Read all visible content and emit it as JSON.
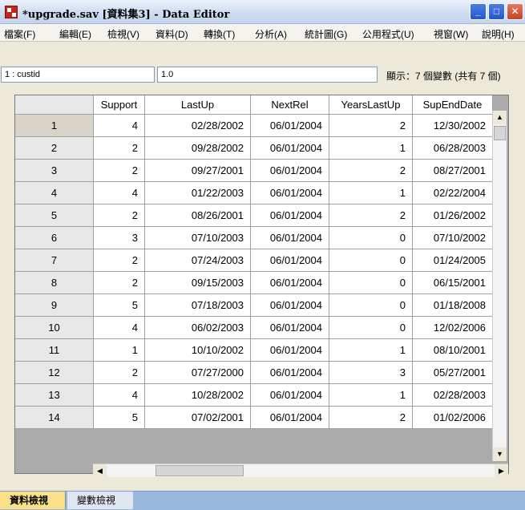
{
  "window": {
    "title": "*upgrade.sav [資料集3] - Data Editor",
    "controls": {
      "minimize": "_",
      "maximize": "□",
      "close": "✕"
    }
  },
  "menu": [
    "檔案(F)",
    "編輯(E)",
    "檢視(V)",
    "資料(D)",
    "轉換(T)",
    "分析(A)",
    "統計圖(G)",
    "公用程式(U)",
    "視窗(W)",
    "說明(H)"
  ],
  "formula": {
    "cell_ref": "1 : custid",
    "cell_value": "1.0",
    "variable_count": "顯示：7 個變數 (共有 7 個)"
  },
  "grid": {
    "columns": [
      "Support",
      "LastUp",
      "NextRel",
      "YearsLastUp",
      "SupEndDate"
    ],
    "rows": [
      {
        "num": "1",
        "values": [
          "4",
          "02/28/2002",
          "06/01/2004",
          "2",
          "12/30/2002"
        ]
      },
      {
        "num": "2",
        "values": [
          "2",
          "09/28/2002",
          "06/01/2004",
          "1",
          "06/28/2003"
        ]
      },
      {
        "num": "3",
        "values": [
          "2",
          "09/27/2001",
          "06/01/2004",
          "2",
          "08/27/2001"
        ]
      },
      {
        "num": "4",
        "values": [
          "4",
          "01/22/2003",
          "06/01/2004",
          "1",
          "02/22/2004"
        ]
      },
      {
        "num": "5",
        "values": [
          "2",
          "08/26/2001",
          "06/01/2004",
          "2",
          "01/26/2002"
        ]
      },
      {
        "num": "6",
        "values": [
          "3",
          "07/10/2003",
          "06/01/2004",
          "0",
          "07/10/2002"
        ]
      },
      {
        "num": "7",
        "values": [
          "2",
          "07/24/2003",
          "06/01/2004",
          "0",
          "01/24/2005"
        ]
      },
      {
        "num": "8",
        "values": [
          "2",
          "09/15/2003",
          "06/01/2004",
          "0",
          "06/15/2001"
        ]
      },
      {
        "num": "9",
        "values": [
          "5",
          "07/18/2003",
          "06/01/2004",
          "0",
          "01/18/2008"
        ]
      },
      {
        "num": "10",
        "values": [
          "4",
          "06/02/2003",
          "06/01/2004",
          "0",
          "12/02/2006"
        ]
      },
      {
        "num": "11",
        "values": [
          "1",
          "10/10/2002",
          "06/01/2004",
          "1",
          "08/10/2001"
        ]
      },
      {
        "num": "12",
        "values": [
          "2",
          "07/27/2000",
          "06/01/2004",
          "3",
          "05/27/2001"
        ]
      },
      {
        "num": "13",
        "values": [
          "4",
          "10/28/2002",
          "06/01/2004",
          "1",
          "02/28/2003"
        ]
      },
      {
        "num": "14",
        "values": [
          "5",
          "07/02/2001",
          "06/01/2004",
          "2",
          "01/02/2006"
        ]
      }
    ]
  },
  "tabs": {
    "data_view": "資料檢視",
    "variable_view": "變數檢視",
    "active": "data_view"
  },
  "scroll": {
    "up": "▲",
    "down": "▼",
    "left": "◀",
    "right": "▶"
  }
}
